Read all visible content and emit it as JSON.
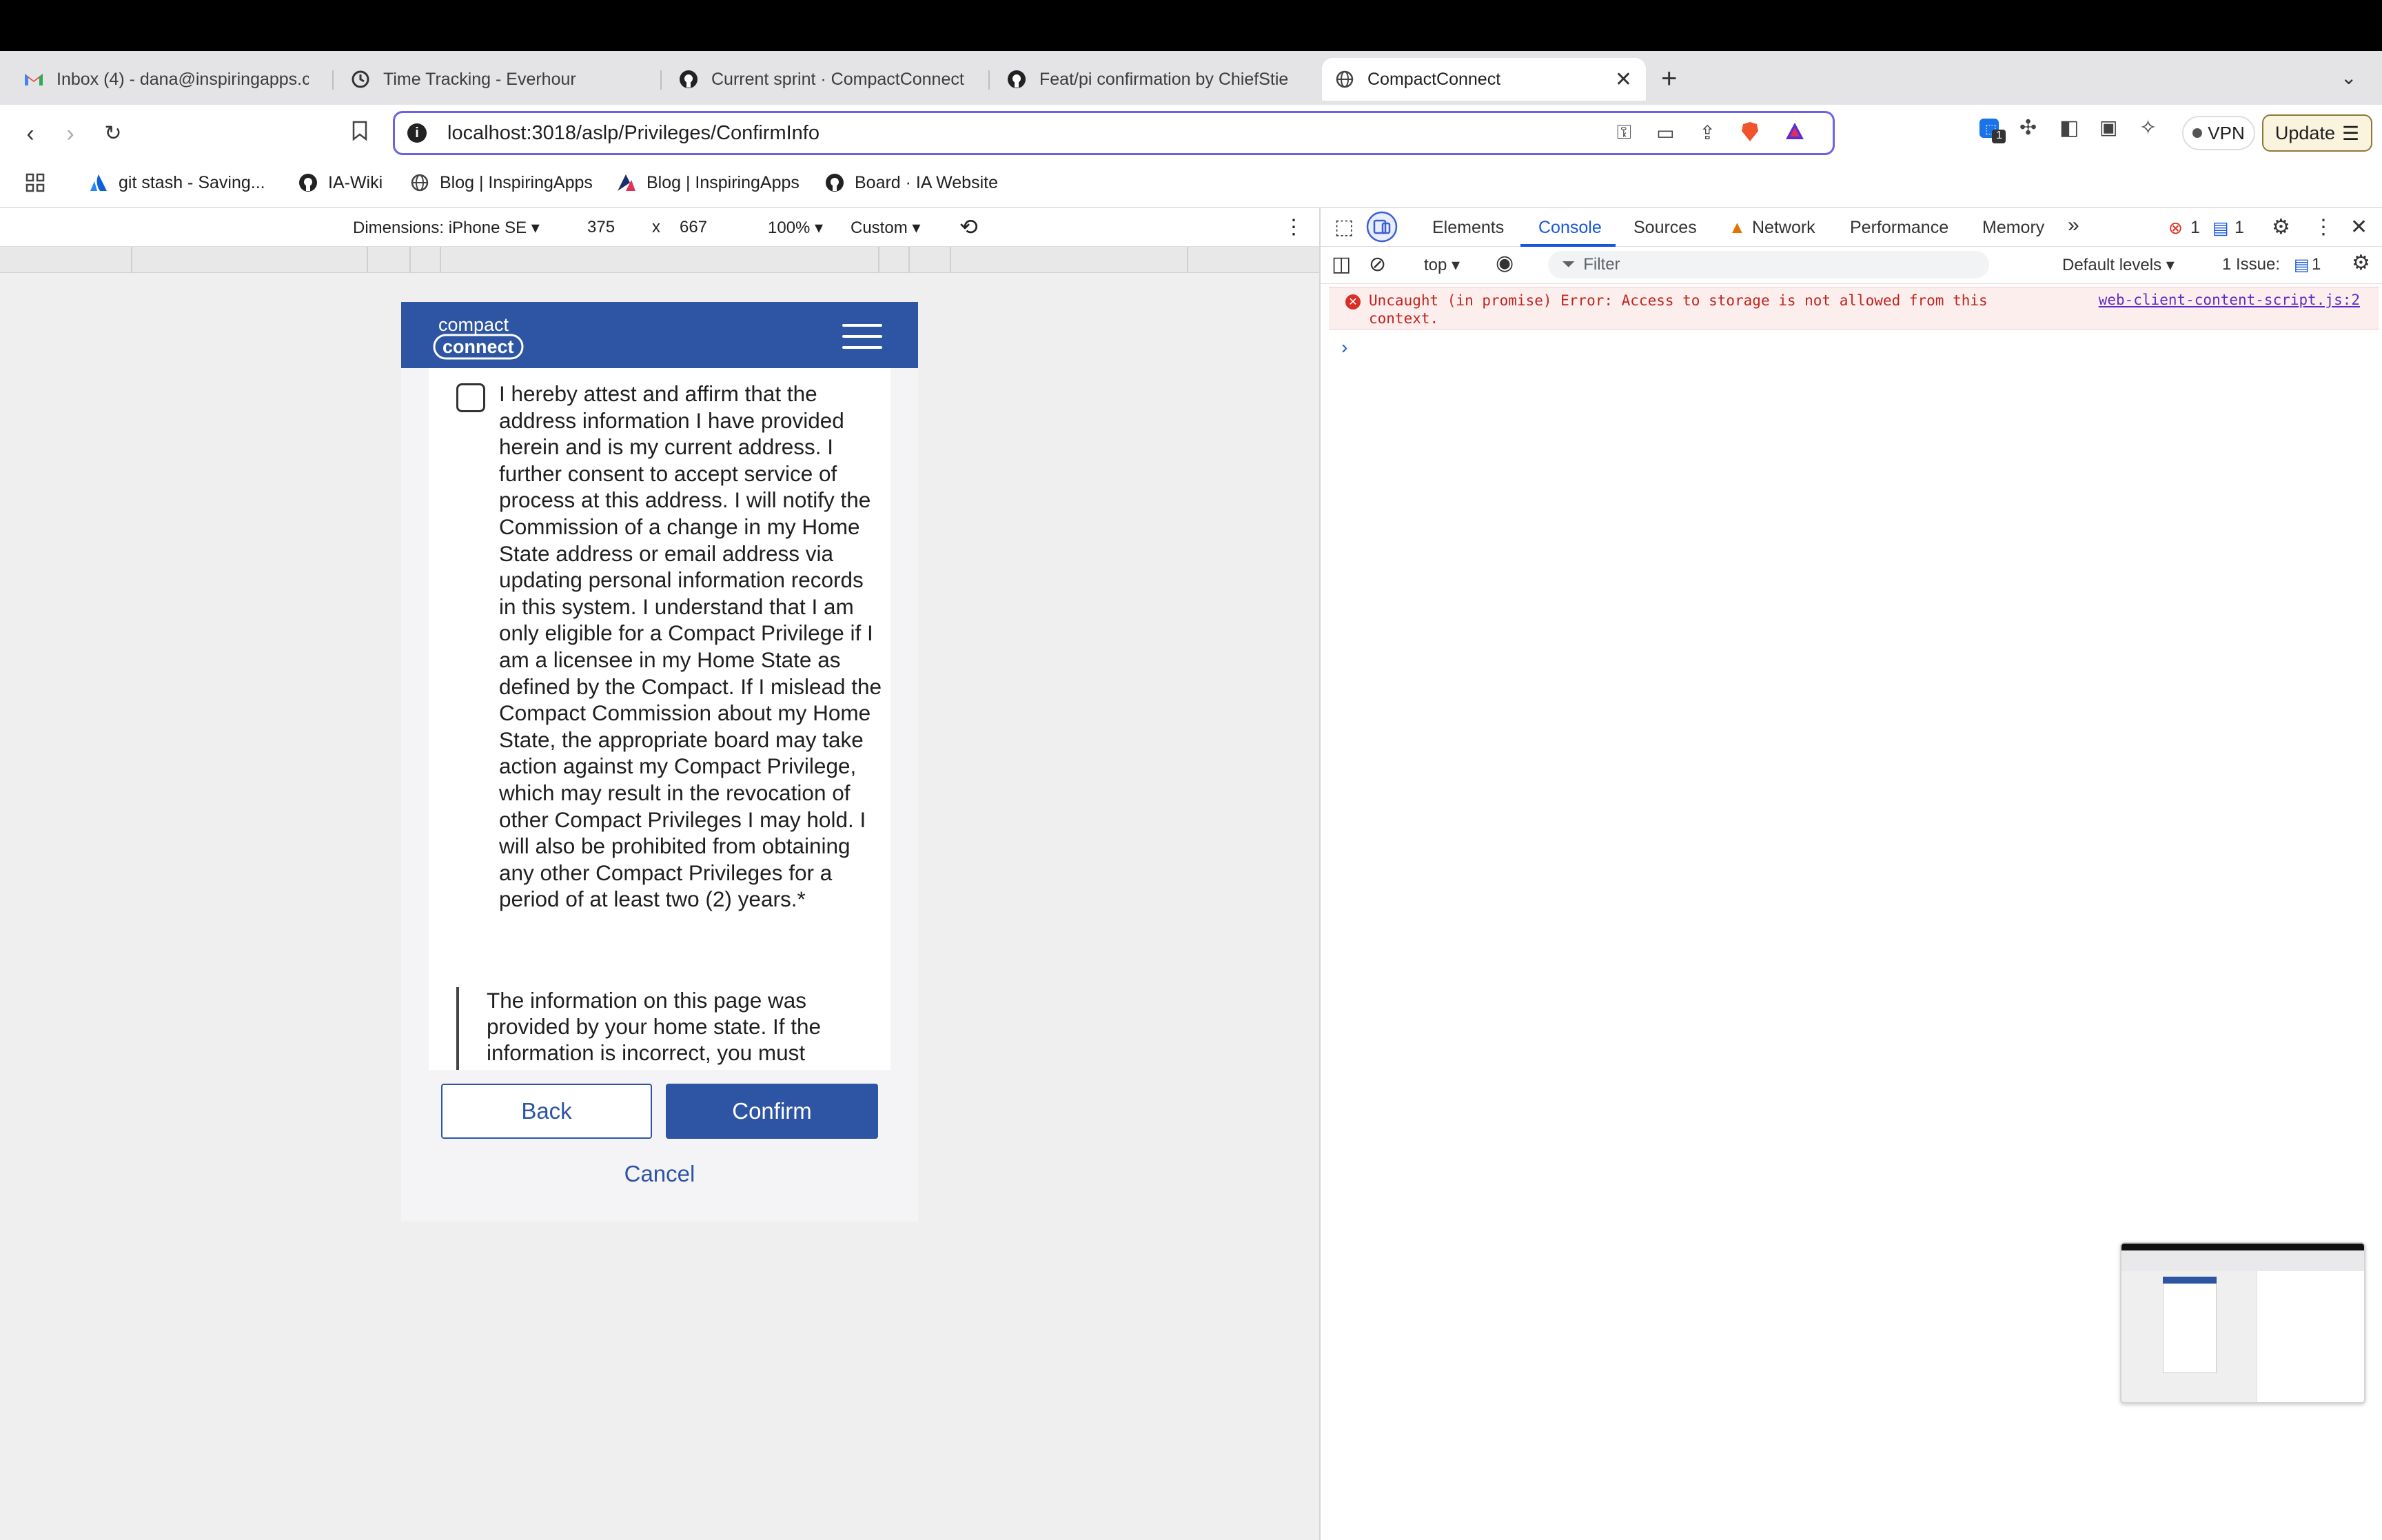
{
  "browser": {
    "tabs": [
      {
        "label": "Inbox (4) - dana@inspiringapps.c",
        "icon": "gmail-icon"
      },
      {
        "label": "Time Tracking - Everhour",
        "icon": "everhour-icon"
      },
      {
        "label": "Current sprint · CompactConnect",
        "icon": "github-icon"
      },
      {
        "label": "Feat/pi confirmation by ChiefStie",
        "icon": "github-icon"
      },
      {
        "label": "CompactConnect",
        "icon": "globe-icon",
        "active": true
      }
    ],
    "address": "localhost:3018/aslp/Privileges/ConfirmInfo",
    "vpn_label": "VPN",
    "update_label": "Update",
    "extension_badge": "1",
    "bookmarks": [
      {
        "label": "git stash - Saving...",
        "icon": "atlassian-icon"
      },
      {
        "label": "IA-Wiki",
        "icon": "github-icon"
      },
      {
        "label": "Blog | InspiringApps",
        "icon": "globe-icon"
      },
      {
        "label": "Blog | InspiringApps",
        "icon": "ia-logo-icon"
      },
      {
        "label": "Board · IA Website",
        "icon": "github-icon"
      }
    ]
  },
  "device_toolbar": {
    "dimensions_label": "Dimensions: iPhone SE ▾",
    "width": "375",
    "times": "x",
    "height": "667",
    "zoom": "100% ▾",
    "throttle": "Custom ▾"
  },
  "page": {
    "logo_line1": "compact",
    "logo_line2": "connect",
    "attestation_text": "I hereby attest and affirm that the address information I have provided herein and is my current address. I further consent to accept service of process at this address. I will notify the Commission of a change in my Home State address or email address via updating personal information records in this system. I understand that I am only eligible for a Compact Privilege if I am a licensee in my Home State as defined by the Compact. If I mislead the Compact Commission about my Home State, the appropriate board may take action against my Compact Privilege, which may result in the revocation of other Compact Privileges I may hold. I will also be prohibited from obtaining any other Compact Privileges for a period of at least two (2) years.*",
    "info_note": "The information on this page was provided by your home state. If the information is incorrect, you must",
    "back_label": "Back",
    "confirm_label": "Confirm",
    "cancel_label": "Cancel",
    "brand_color": "#2E55A3"
  },
  "devtools": {
    "tabs": [
      "Elements",
      "Console",
      "Sources",
      "Network",
      "Performance",
      "Memory"
    ],
    "active_tab": "Console",
    "more": "»",
    "error_count": "1",
    "message_count": "1",
    "context": "top ▾",
    "filter_placeholder": "Filter",
    "levels": "Default levels ▾",
    "issues_label": "1 Issue:",
    "issues_count": "1",
    "error_message": "Uncaught (in promise) Error: Access to storage is not allowed from this context.",
    "error_source": "web-client-content-script.js:2",
    "prompt": "›"
  }
}
